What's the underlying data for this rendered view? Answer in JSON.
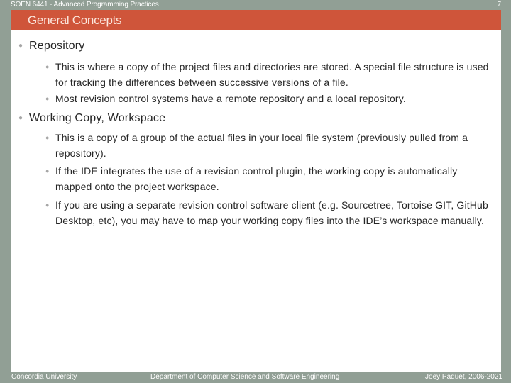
{
  "header": {
    "course_title": "SOEN 6441 - Advanced Programming Practices",
    "page_number": "7"
  },
  "slide": {
    "title": "General Concepts",
    "bullet_icon": "bullet-dot",
    "items": [
      {
        "label": "Repository",
        "subitems": [
          "This is where a copy of the project files and directories are stored. A special file structure is used for tracking the differences between successive versions of a file.",
          "Most revision control systems have a remote repository and a local repository."
        ]
      },
      {
        "label": "Working Copy, Workspace",
        "subitems": [
          "This is a copy of a group of the actual files in your local file system (previously pulled from a repository).",
          "If the IDE integrates the use of a revision control plugin, the working copy is automatically mapped onto the project workspace.",
          "If you are using a separate revision control software client (e.g. Sourcetree, Tortoise GIT, GitHub Desktop, etc), you may have to map your working copy files into the IDE’s workspace manually."
        ]
      }
    ]
  },
  "footer": {
    "left": "Concordia University",
    "center": "Department of Computer Science and Software Engineering",
    "right": "Joey Paquet, 2006-2021"
  },
  "colors": {
    "frame": "#919f95",
    "title_bar": "#cf553a",
    "title_text": "#fbe6dc",
    "body_text": "#262626",
    "bullet": "#a6a6a6"
  }
}
